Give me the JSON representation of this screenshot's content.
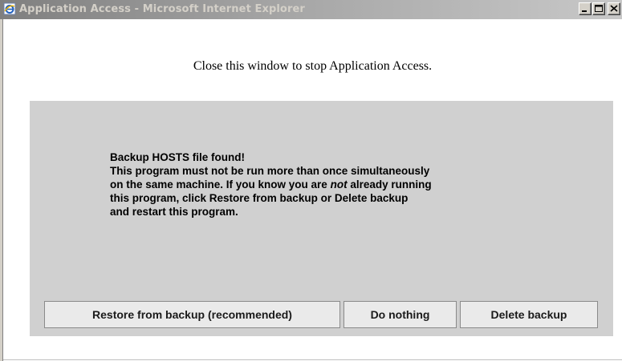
{
  "window": {
    "title": "Application Access - Microsoft Internet Explorer",
    "icon": "internet-explorer-icon",
    "controls": {
      "minimize": "minimize-icon",
      "maximize": "maximize-icon",
      "close": "close-icon"
    }
  },
  "page": {
    "instruction": "Close this window to stop Application Access."
  },
  "panel": {
    "message": {
      "line1": "Backup HOSTS file found!",
      "line2": "This program must not be run more than once simultaneously",
      "line3_pre": "on the same machine. If you know you are ",
      "line3_em": "not",
      "line3_post": " already running",
      "line4": "this program, click Restore from backup or Delete backup",
      "line5": "and restart this program."
    },
    "buttons": {
      "restore": "Restore from backup (recommended)",
      "nothing": "Do nothing",
      "delete": "Delete backup"
    }
  },
  "colors": {
    "panel_bg": "#d0d0d0",
    "button_bg": "#eaeaea",
    "title_text": "#d4d0c8"
  }
}
